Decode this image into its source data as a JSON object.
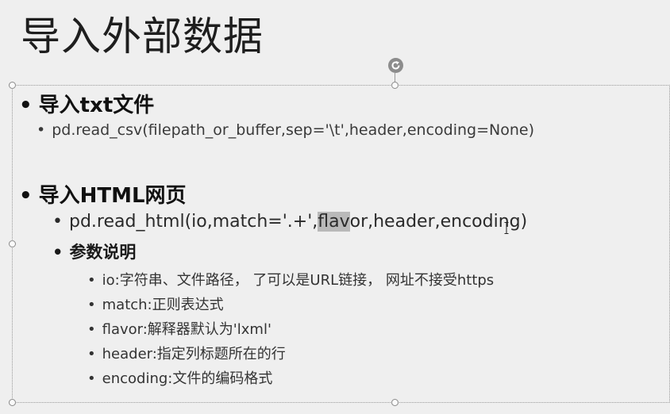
{
  "slide": {
    "title": "导入外部数据",
    "section1": {
      "heading": "导入txt文件",
      "item": "pd.read_csv(filepath_or_buffer,sep='\\t',header,encoding=None)"
    },
    "section2": {
      "heading": "导入HTML网页",
      "item_pre": "pd.read_html(io,match='.+',",
      "item_highlight": "flav",
      "item_post": "or,header,encoding)",
      "params_heading": "参数说明",
      "params": [
        "io:字符串、文件路径， 了可以是URL链接， 网址不接受https",
        "match:正则表达式",
        "flavor:解释器默认为'lxml'",
        "header:指定列标题所在的行",
        "encoding:文件的编码格式"
      ]
    }
  },
  "bullet": "•",
  "icons": {
    "rotate": "rotate-handle-icon",
    "text_cursor": "ibeam-cursor-icon"
  }
}
